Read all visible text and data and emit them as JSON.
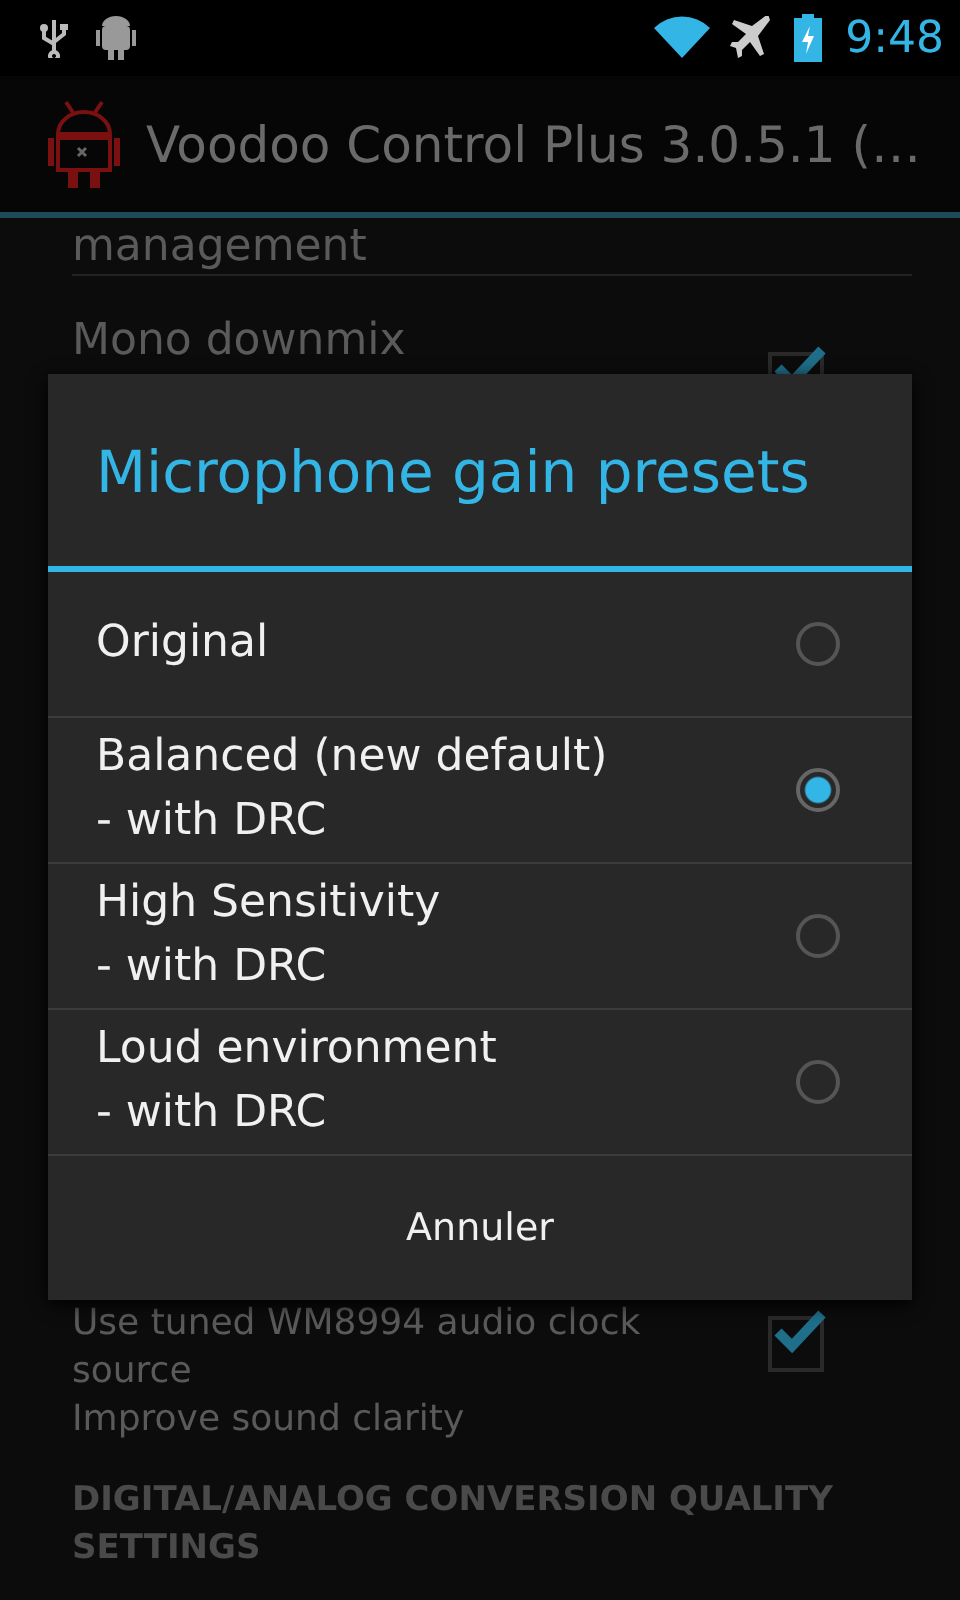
{
  "status_bar": {
    "time": "9:48"
  },
  "action_bar": {
    "title": "Voodoo Control Plus 3.0.5.1 (…"
  },
  "settings_top": [
    {
      "kind": "text",
      "title": "management"
    },
    {
      "kind": "checkbox",
      "title": "Mono downmix",
      "checked": true
    }
  ],
  "settings_bottom": [
    {
      "kind": "checkbox",
      "summary": "Use tuned WM8994 audio clock source\nImprove sound clarity",
      "checked": true
    },
    {
      "kind": "header",
      "title": "DIGITAL/ANALOG CONVERSION QUALITY SETTINGS"
    }
  ],
  "dialog": {
    "title": "Microphone gain presets",
    "options": [
      {
        "label": "Original",
        "selected": false
      },
      {
        "label": "Balanced (new default)\n- with DRC",
        "selected": true
      },
      {
        "label": "High Sensitivity\n- with DRC",
        "selected": false
      },
      {
        "label": "Loud environment\n- with DRC",
        "selected": false
      }
    ],
    "button": "Annuler"
  }
}
